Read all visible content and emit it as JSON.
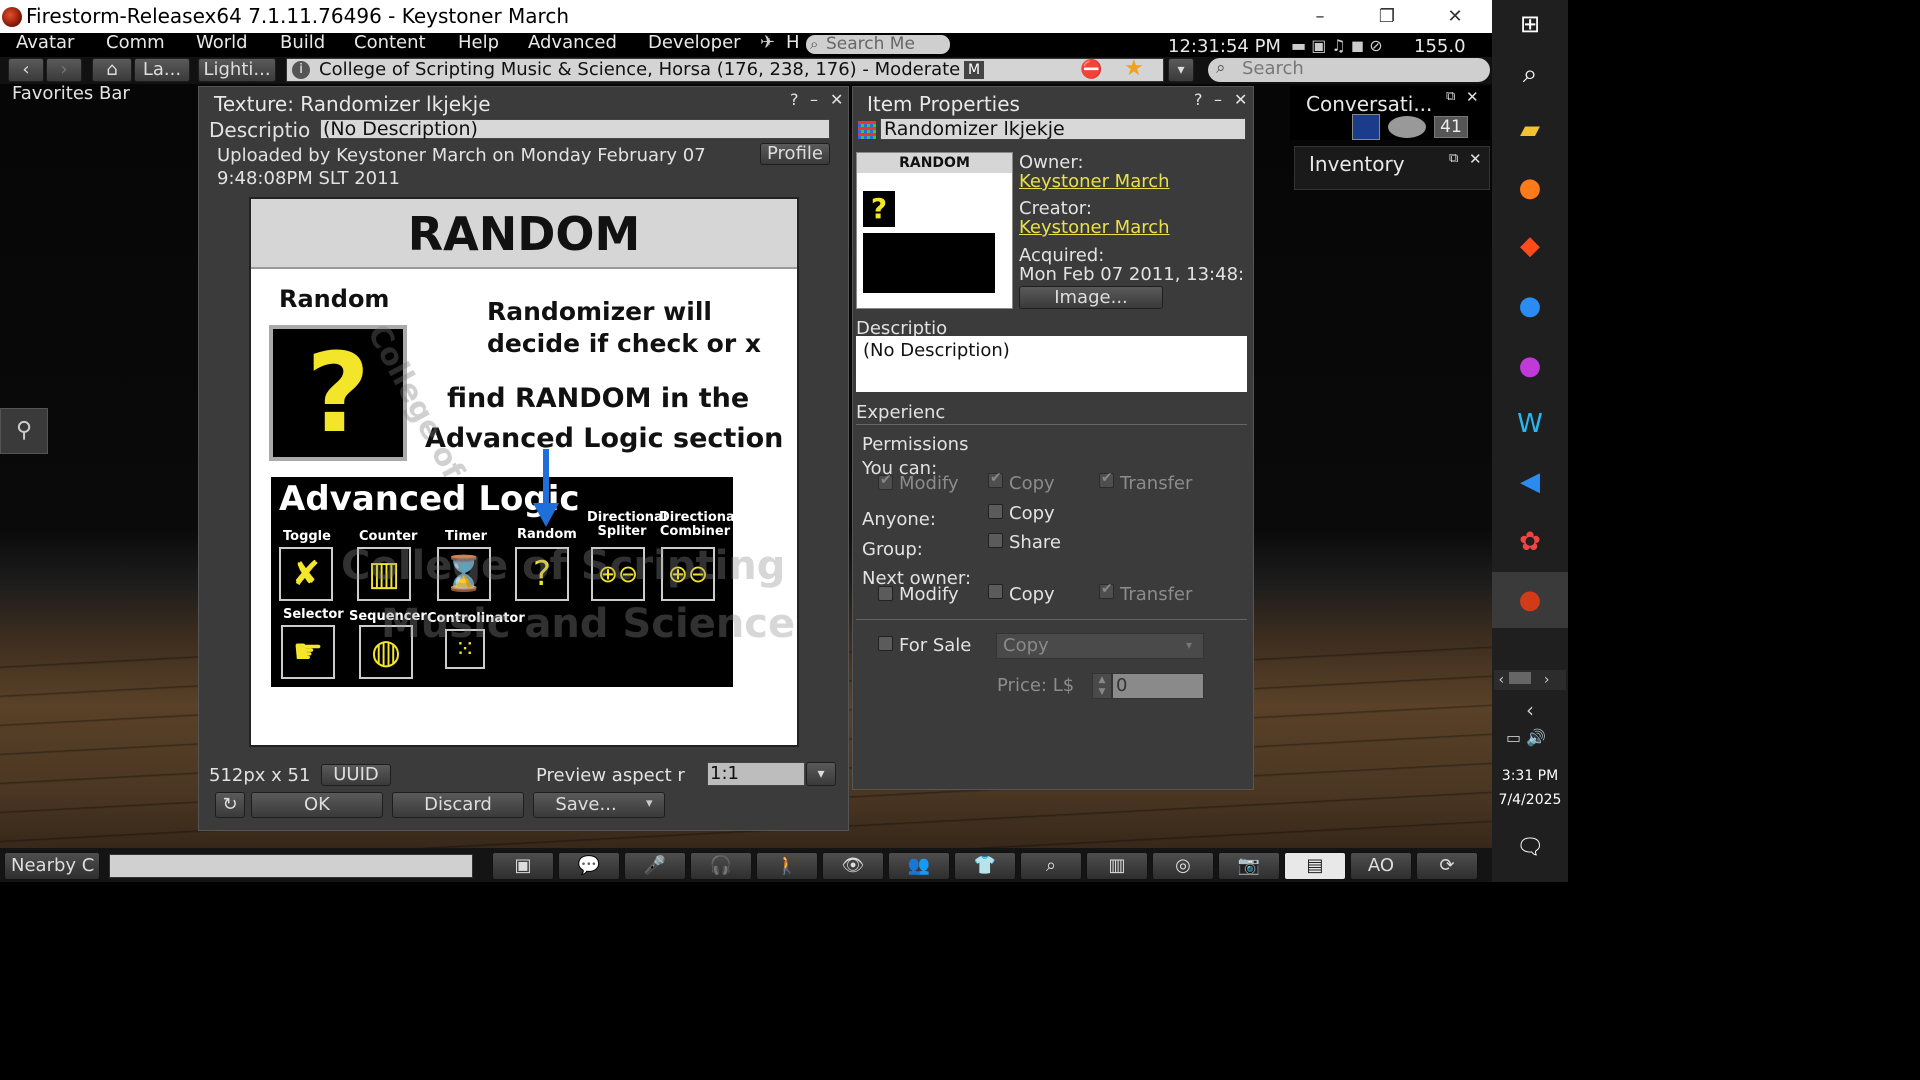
{
  "window": {
    "title": "Firestorm-Releasex64 7.1.11.76496 - Keystoner March",
    "minimize": "–",
    "maximize": "❐",
    "close": "✕"
  },
  "menu": [
    "Avatar",
    "Comm",
    "World",
    "Build",
    "Content",
    "Help",
    "Advanced",
    "Developer"
  ],
  "menu_h": "H",
  "search_me": "Search Me",
  "status": {
    "time": "12:31:54 PM",
    "balance": "155.0"
  },
  "nav": {
    "home_label": "La...",
    "lighting_label": "Lighti...",
    "location": "College of Scripting Music & Science, Horsa (176, 238, 176) - Moderate",
    "rating_badge": "M",
    "search_placeholder": "Search"
  },
  "favorites_bar": "Favorites Bar",
  "texture": {
    "title": "Texture: Randomizer lkjekje",
    "help": "?",
    "min": "–",
    "close": "✕",
    "desc_label": "Descriptio",
    "desc_value": "(No Description)",
    "uploaded_line1": "Uploaded by Keystoner March on Monday February 07",
    "uploaded_line2": "9:48:08PM SLT 2011",
    "profile_btn": "Profile",
    "size_text": "512px x 51",
    "uuid_btn": "UUID",
    "aspect_label": "Preview aspect r",
    "aspect_value": "1:1",
    "ok_btn": "OK",
    "discard_btn": "Discard",
    "save_btn": "Save...",
    "image": {
      "heading": "RANDOM",
      "random_label": "Random",
      "line1": "Randomizer will",
      "line2": "decide if check or x",
      "line3": "find RANDOM in the",
      "line4": "Advanced Logic section",
      "adv_title": "Advanced Logic",
      "icons": [
        "Toggle",
        "Counter",
        "Timer",
        "Random",
        "Directional Spliter",
        "Directional Combiner",
        "Selector",
        "Sequencer",
        "Controlinator"
      ],
      "watermark1": "College of Scripting",
      "watermark2": "Music and Science"
    }
  },
  "item": {
    "title": "Item Properties",
    "help": "?",
    "min": "–",
    "close": "✕",
    "name": "Randomizer lkjekje",
    "thumb_heading": "RANDOM",
    "owner_label": "Owner:",
    "owner": "Keystoner March",
    "creator_label": "Creator:",
    "creator": "Keystoner March",
    "acquired_label": "Acquired:",
    "acquired": "Mon Feb 07 2011, 13:48:",
    "image_btn": "Image...",
    "desc_label": "Descriptio",
    "desc_value": "(No Description)",
    "experience_label": "Experienc",
    "permissions_label": "Permissions",
    "you_can": "You can:",
    "modify": "Modify",
    "copy": "Copy",
    "transfer": "Transfer",
    "anyone_label": "Anyone:",
    "anyone_copy": "Copy",
    "group_label": "Group:",
    "group_share": "Share",
    "next_owner_label": "Next owner:",
    "for_sale": "For Sale",
    "sale_type": "Copy",
    "price_label": "Price: L$",
    "price_value": "0"
  },
  "conversations": {
    "title": "Conversati...",
    "count": "41"
  },
  "inventory": {
    "title": "Inventory"
  },
  "bottom": {
    "nearby_chat": "Nearby C",
    "ao": "AO"
  },
  "taskbar": {
    "time": "3:31 PM",
    "date": "7/4/2025"
  },
  "colors": {
    "panel": "#3b3b3b",
    "link": "#e9e04a",
    "accent_blue": "#1e6fd9"
  }
}
